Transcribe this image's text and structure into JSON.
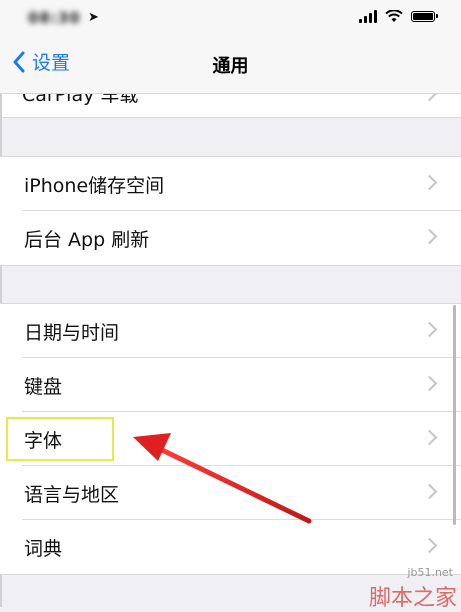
{
  "status_bar": {
    "time": "08:30",
    "location_icon": "location-arrow-icon",
    "signal_icon": "cellular-signal-icon",
    "wifi_icon": "wifi-icon",
    "battery_icon": "battery-icon"
  },
  "nav": {
    "back_label": "设置",
    "title": "通用"
  },
  "rows": {
    "carplay": "CarPlay 车载",
    "iphone_storage": "iPhone储存空间",
    "background_refresh": "后台 App 刷新",
    "date_time": "日期与时间",
    "keyboard": "键盘",
    "fonts": "字体",
    "language_region": "语言与地区",
    "dictionary": "词典"
  },
  "watermark": {
    "site": "jb51.net",
    "brand": "脚本之家"
  },
  "colors": {
    "accent": "#1a7cf5",
    "highlight_box": "#e8e84a",
    "arrow": "#e02020"
  }
}
